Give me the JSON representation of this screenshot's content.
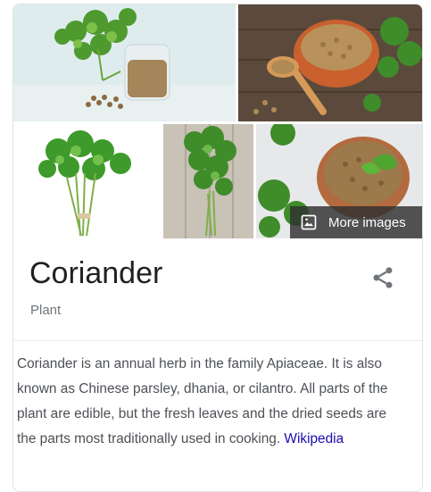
{
  "gallery": {
    "more_images_label": "More images",
    "images": [
      {
        "name": "coriander-sprig-and-seed-jar"
      },
      {
        "name": "coriander-seeds-in-bowl-with-spoon"
      },
      {
        "name": "coriander-bunch-white-background"
      },
      {
        "name": "coriander-bunch-on-wood"
      },
      {
        "name": "coriander-seeds-pot-with-leaf"
      }
    ]
  },
  "header": {
    "title": "Coriander",
    "subtitle": "Plant",
    "share_icon": "share-icon"
  },
  "description": {
    "text": "Coriander is an annual herb in the family Apiaceae. It is also known as Chinese parsley, dhania, or cilantro. All parts of the plant are edible, but the fresh leaves and the dried seeds are the parts most traditionally used in cooking. ",
    "source_link": "Wikipedia"
  },
  "colors": {
    "title": "#202124",
    "subtitle": "#70757a",
    "body": "#4d5156",
    "link": "#1a0dab",
    "overlay": "#303030"
  }
}
